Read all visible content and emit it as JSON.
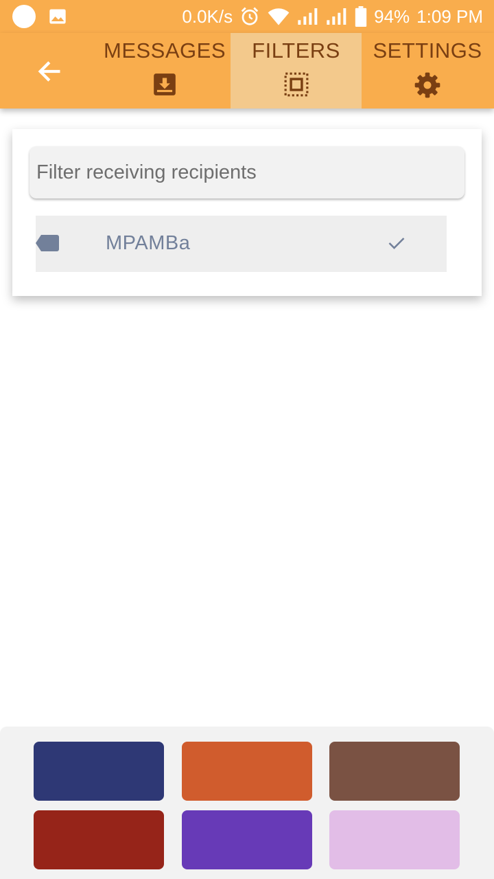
{
  "status_bar": {
    "net_speed": "0.0K/s",
    "battery": "94%",
    "time": "1:09 PM",
    "icons": [
      "notification-dot-icon",
      "image-icon",
      "alarm-icon",
      "wifi-icon",
      "signal-icon",
      "signal-icon",
      "battery-icon"
    ]
  },
  "appbar": {
    "back_icon": "arrow-left-icon",
    "tabs": [
      {
        "label": "MESSAGES",
        "icon": "inbox-download-icon",
        "selected": false
      },
      {
        "label": "FILTERS",
        "icon": "select-frame-icon",
        "selected": true
      },
      {
        "label": "SETTINGS",
        "icon": "gear-icon",
        "selected": false
      }
    ]
  },
  "filter": {
    "placeholder": "Filter receiving recipients",
    "value": "",
    "items": [
      {
        "label": "MPAMBa",
        "icon": "tag-icon",
        "checked": true
      }
    ]
  },
  "palette": {
    "colors": [
      "#2e3875",
      "#d05c2d",
      "#7a5243",
      "#962419",
      "#673ab7",
      "#e2bde7"
    ]
  },
  "colors": {
    "accent": "#f9ad4d",
    "tab_selected": "#f3c98c",
    "tab_text": "#7a3f12",
    "item_text": "#72809a"
  }
}
